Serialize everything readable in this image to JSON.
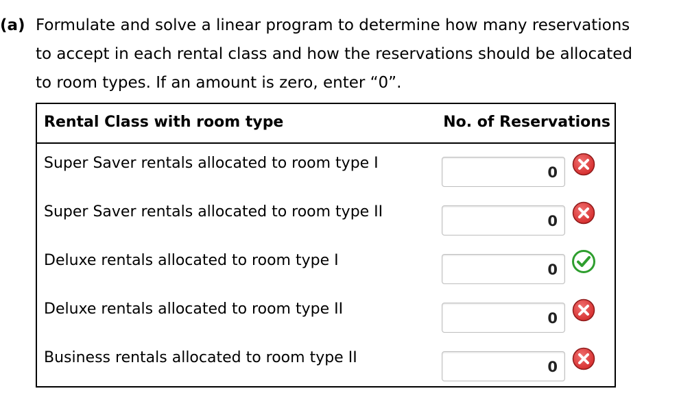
{
  "question": {
    "label": "(a)",
    "line1": "Formulate and solve a linear program to determine how many reservations",
    "line2": "to accept in each rental class and how the reservations should be allocated",
    "line3": "to room types. If an amount is zero, enter “0”."
  },
  "table": {
    "header_left": "Rental Class with room type",
    "header_right": "No. of Reservations",
    "rows": [
      {
        "label": "Super Saver rentals allocated to room type I",
        "value": "0",
        "status": "incorrect"
      },
      {
        "label": "Super Saver rentals allocated to room type II",
        "value": "0",
        "status": "incorrect"
      },
      {
        "label": "Deluxe rentals allocated to room type I",
        "value": "0",
        "status": "correct"
      },
      {
        "label": "Deluxe rentals allocated to room type II",
        "value": "0",
        "status": "incorrect"
      },
      {
        "label": "Business rentals allocated to room type II",
        "value": "0",
        "status": "incorrect"
      }
    ]
  },
  "colors": {
    "incorrect": "#d42a2a",
    "correct": "#2e9e2e"
  },
  "icons": {
    "incorrect": "x-circle-icon",
    "correct": "check-circle-icon"
  }
}
